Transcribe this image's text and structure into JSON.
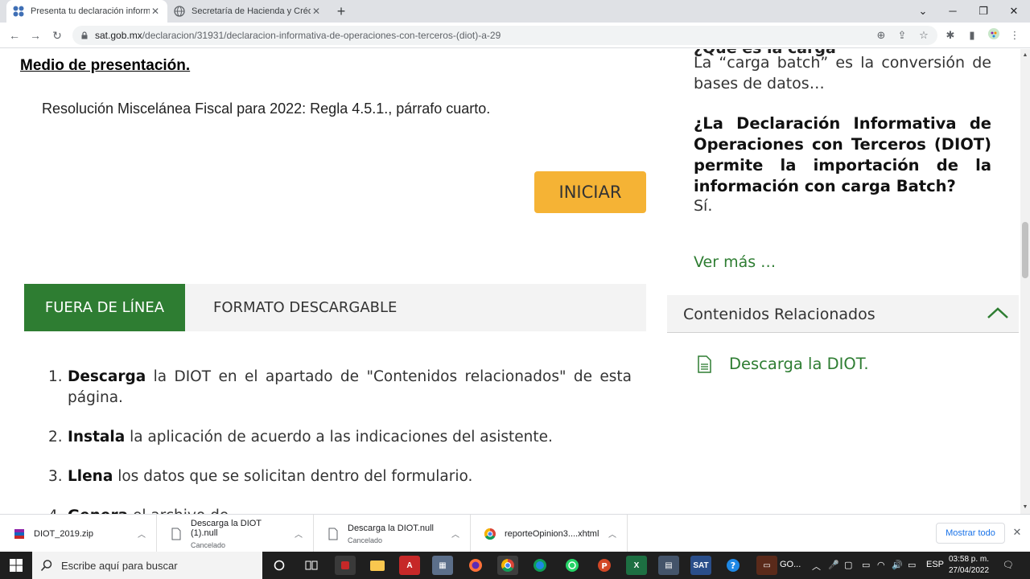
{
  "browser": {
    "tabs": [
      {
        "title": "Presenta tu declaración informativa",
        "active": true
      },
      {
        "title": "Secretaría de Hacienda y Crédito Público",
        "active": false
      }
    ],
    "new_tab": "+",
    "address": {
      "host": "sat.gob.mx",
      "path": "/declaracion/31931/declaracion-informativa-de-operaciones-con-terceros-(diot)-a-29"
    }
  },
  "page": {
    "heading": "Medio de presentación.",
    "resolution": "Resolución Miscelánea Fiscal para 2022: Regla 4.5.1., párrafo cuarto.",
    "iniciar_label": "INICIAR",
    "tabs": {
      "fuera": "FUERA DE LÍNEA",
      "formato": "FORMATO DESCARGABLE"
    },
    "steps": [
      {
        "num": "1.",
        "bold": "Descarga",
        "rest": " la DIOT en el apartado de \"Contenidos relacionados\" de esta página."
      },
      {
        "num": "2.",
        "bold": "Instala",
        "rest": " la aplicación de acuerdo a las indicaciones del asistente."
      },
      {
        "num": "3.",
        "bold": "Llena",
        "rest": " los datos que se solicitan dentro del formulario."
      },
      {
        "num": "4.",
        "bold": "Genera",
        "rest": " el archivo de"
      }
    ]
  },
  "sidebar": {
    "faq_cut_question": "¿Qué es la carga",
    "faq1_answer": "La “carga batch” es la conversión de bases de datos…",
    "faq2_question": "¿La Declaración Informativa de Operaciones con Terceros (DIOT) permite la importación de la información con carga Batch?",
    "faq2_answer": "Sí.",
    "ver_mas": "Ver más …",
    "related_title": "Contenidos Relacionados",
    "related_item": "Descarga la DIOT."
  },
  "downloads": {
    "items": [
      {
        "name": "DIOT_2019.zip",
        "status": ""
      },
      {
        "name": "Descarga la DIOT (1).null",
        "status": "Cancelado"
      },
      {
        "name": "Descarga la DIOT.null",
        "status": "Cancelado"
      },
      {
        "name": "reporteOpinion3....xhtml",
        "status": ""
      }
    ],
    "show_all": "Mostrar todo"
  },
  "taskbar": {
    "search_placeholder": "Escribe aquí para buscar",
    "go_label": "GO...",
    "lang": "ESP",
    "time": "03:58 p. m.",
    "date": "27/04/2022"
  },
  "colors": {
    "green": "#2e7d32",
    "orange": "#f5b335"
  }
}
